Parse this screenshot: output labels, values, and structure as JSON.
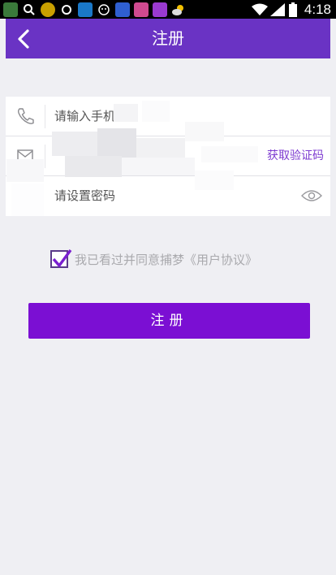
{
  "status_bar": {
    "time": "4:18",
    "left_icons": [
      "app-icon-a",
      "search-icon",
      "app-icon-b",
      "app-icon-c",
      "app-icon-d",
      "app-icon-e",
      "paw-icon",
      "app-icon-f",
      "app-icon-g",
      "weather-icon"
    ],
    "right_icons": [
      "wifi-icon",
      "signal-icon",
      "battery-icon"
    ]
  },
  "header": {
    "title": "注册",
    "accent": "#6a33c4"
  },
  "form": {
    "phone": {
      "icon": "phone-icon",
      "value": "请输入手机"
    },
    "code": {
      "icon": "mail-icon",
      "get_code_label": "获取验证码"
    },
    "password": {
      "icon": "eye-icon",
      "placeholder": "请设置密码"
    }
  },
  "agreement": {
    "checked": true,
    "text": "我已看过并同意捕梦《用户协议》"
  },
  "submit": {
    "label": "注册",
    "color": "#7b0fd3"
  }
}
